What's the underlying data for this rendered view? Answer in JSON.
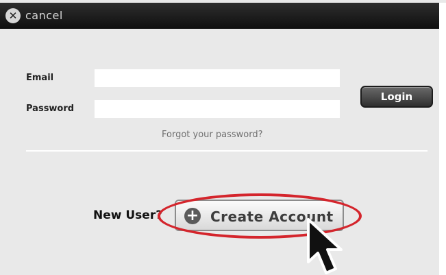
{
  "titlebar": {
    "close_label": "cancel",
    "close_icon": "close-icon"
  },
  "form": {
    "email_label": "Email",
    "email_value": "",
    "password_label": "Password",
    "password_value": "",
    "login_label": "Login",
    "forgot_link": "Forgot your password?"
  },
  "signup": {
    "prompt": "New User?",
    "button_label": "Create Account",
    "button_icon": "plus-icon"
  },
  "annotation": {
    "highlight_color": "#d4252c",
    "cursor_icon": "mouse-pointer-icon"
  }
}
